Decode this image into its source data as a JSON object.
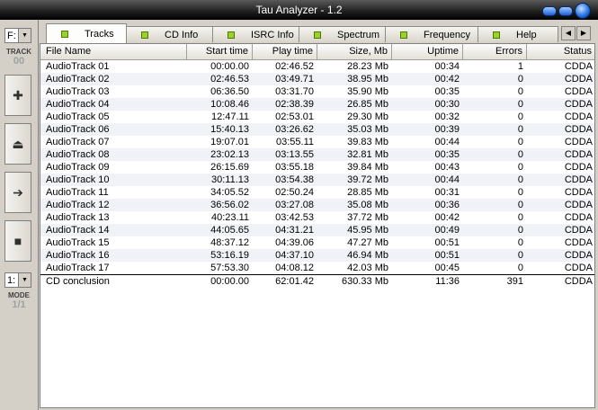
{
  "window": {
    "title": "Tau Analyzer - 1.2"
  },
  "sidebar": {
    "drive_value": "F:",
    "track_label": "TRACK",
    "track_number": "00",
    "mode_value": "1:",
    "mode_label": "MODE",
    "mode_number": "1/1"
  },
  "tabs": [
    {
      "label": "Tracks"
    },
    {
      "label": "CD Info"
    },
    {
      "label": "ISRC Info"
    },
    {
      "label": "Spectrum"
    },
    {
      "label": "Frequency"
    },
    {
      "label": "Help"
    }
  ],
  "table": {
    "columns": [
      "File Name",
      "Start time",
      "Play time",
      "Size, Mb",
      "Uptime",
      "Errors",
      "Status"
    ],
    "rows": [
      [
        "AudioTrack 01",
        "00:00.00",
        "02:46.52",
        "28.23 Mb",
        "00:34",
        "1",
        "CDDA"
      ],
      [
        "AudioTrack 02",
        "02:46.53",
        "03:49.71",
        "38.95 Mb",
        "00:42",
        "0",
        "CDDA"
      ],
      [
        "AudioTrack 03",
        "06:36.50",
        "03:31.70",
        "35.90 Mb",
        "00:35",
        "0",
        "CDDA"
      ],
      [
        "AudioTrack 04",
        "10:08.46",
        "02:38.39",
        "26.85 Mb",
        "00:30",
        "0",
        "CDDA"
      ],
      [
        "AudioTrack 05",
        "12:47.11",
        "02:53.01",
        "29.30 Mb",
        "00:32",
        "0",
        "CDDA"
      ],
      [
        "AudioTrack 06",
        "15:40.13",
        "03:26.62",
        "35.03 Mb",
        "00:39",
        "0",
        "CDDA"
      ],
      [
        "AudioTrack 07",
        "19:07.01",
        "03:55.11",
        "39.83 Mb",
        "00:44",
        "0",
        "CDDA"
      ],
      [
        "AudioTrack 08",
        "23:02.13",
        "03:13.55",
        "32.81 Mb",
        "00:35",
        "0",
        "CDDA"
      ],
      [
        "AudioTrack 09",
        "26:15.69",
        "03:55.18",
        "39.84 Mb",
        "00:43",
        "0",
        "CDDA"
      ],
      [
        "AudioTrack 10",
        "30:11.13",
        "03:54.38",
        "39.72 Mb",
        "00:44",
        "0",
        "CDDA"
      ],
      [
        "AudioTrack 11",
        "34:05.52",
        "02:50.24",
        "28.85 Mb",
        "00:31",
        "0",
        "CDDA"
      ],
      [
        "AudioTrack 12",
        "36:56.02",
        "03:27.08",
        "35.08 Mb",
        "00:36",
        "0",
        "CDDA"
      ],
      [
        "AudioTrack 13",
        "40:23.11",
        "03:42.53",
        "37.72 Mb",
        "00:42",
        "0",
        "CDDA"
      ],
      [
        "AudioTrack 14",
        "44:05.65",
        "04:31.21",
        "45.95 Mb",
        "00:49",
        "0",
        "CDDA"
      ],
      [
        "AudioTrack 15",
        "48:37.12",
        "04:39.06",
        "47.27 Mb",
        "00:51",
        "0",
        "CDDA"
      ],
      [
        "AudioTrack 16",
        "53:16.19",
        "04:37.10",
        "46.94 Mb",
        "00:51",
        "0",
        "CDDA"
      ],
      [
        "AudioTrack 17",
        "57:53.30",
        "04:08.12",
        "42.03 Mb",
        "00:45",
        "0",
        "CDDA"
      ]
    ],
    "summary": [
      "CD conclusion",
      "00:00.00",
      "62:01.42",
      "630.33 Mb",
      "11:36",
      "391",
      "CDDA"
    ]
  },
  "colors": {
    "accent_led": "#9ad12a",
    "title_bar": "#000000",
    "row_alt": "#f1f1f8"
  },
  "icons": [
    "plus-icon",
    "eject-icon",
    "arrow-right-icon",
    "stop-icon",
    "chevron-left-icon",
    "chevron-right-icon"
  ]
}
